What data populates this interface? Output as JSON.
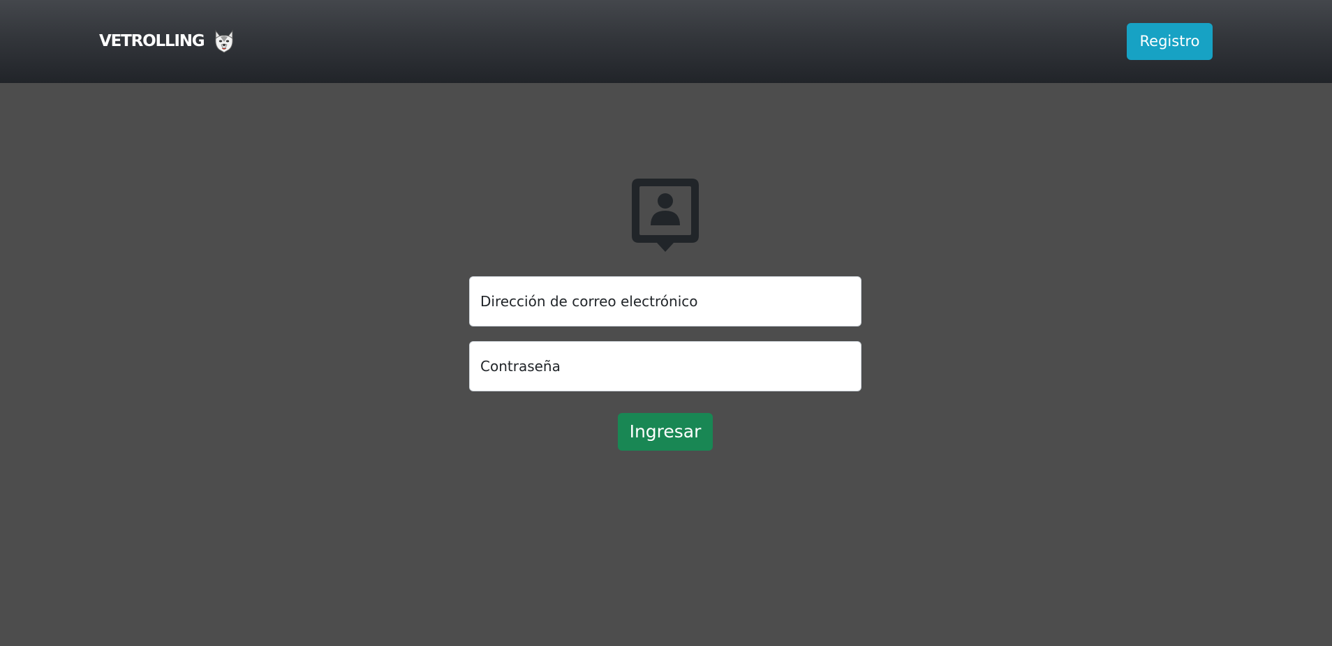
{
  "header": {
    "brand_name": "VETROLLING",
    "logo_icon": "wolf-logo-icon",
    "register_label": "Registro",
    "register_color": "#17a2c4",
    "background": "#2c2f34"
  },
  "login": {
    "icon": "user-login-icon",
    "email_placeholder": "Dirección de correo electrónico",
    "password_placeholder": "Contraseña",
    "submit_label": "Ingresar",
    "submit_color": "#198754"
  },
  "page_background": "#4d4d4d"
}
